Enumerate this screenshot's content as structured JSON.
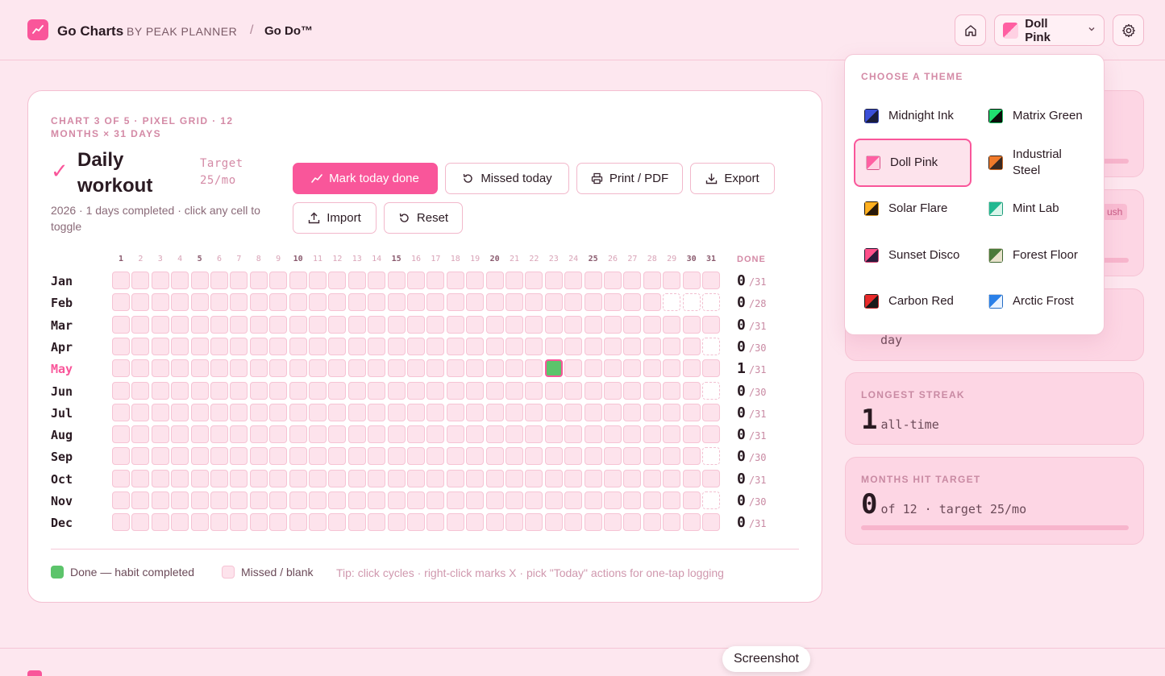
{
  "header": {
    "brand_title": "Go Charts",
    "brand_by": "BY PEAK PLANNER",
    "separator": "/",
    "crumb": "Go Do™",
    "theme_button_label": "Doll Pink"
  },
  "card": {
    "eyebrow": "CHART 3 OF 5 · PIXEL GRID · 12 MONTHS × 31 DAYS",
    "check": "✓",
    "title": "Daily workout",
    "target": "Target 25/mo",
    "subline": "2026 · 1 days completed · click any cell to toggle",
    "buttons": {
      "mark": "Mark today done",
      "missed": "Missed today",
      "print": "Print / PDF",
      "export": "Export",
      "import": "Import",
      "reset": "Reset"
    },
    "done_header": "DONE",
    "legend_done": "Done — habit completed",
    "legend_missed": "Missed / blank",
    "tip": "Tip: click cycles · right-click marks X · pick \"Today\" actions for one-tap logging"
  },
  "chart_data": {
    "type": "heatmap",
    "x": [
      1,
      2,
      3,
      4,
      5,
      6,
      7,
      8,
      9,
      10,
      11,
      12,
      13,
      14,
      15,
      16,
      17,
      18,
      19,
      20,
      21,
      22,
      23,
      24,
      25,
      26,
      27,
      28,
      29,
      30,
      31
    ],
    "bold_days": [
      1,
      5,
      10,
      15,
      20,
      25,
      30,
      31
    ],
    "months": [
      {
        "name": "Jan",
        "days": 31,
        "done": 0,
        "done_days": []
      },
      {
        "name": "Feb",
        "days": 28,
        "done": 0,
        "done_days": []
      },
      {
        "name": "Mar",
        "days": 31,
        "done": 0,
        "done_days": []
      },
      {
        "name": "Apr",
        "days": 30,
        "done": 0,
        "done_days": []
      },
      {
        "name": "May",
        "days": 31,
        "done": 1,
        "done_days": [
          23
        ],
        "current": true
      },
      {
        "name": "Jun",
        "days": 30,
        "done": 0,
        "done_days": []
      },
      {
        "name": "Jul",
        "days": 31,
        "done": 0,
        "done_days": []
      },
      {
        "name": "Aug",
        "days": 31,
        "done": 0,
        "done_days": []
      },
      {
        "name": "Sep",
        "days": 30,
        "done": 0,
        "done_days": []
      },
      {
        "name": "Oct",
        "days": 31,
        "done": 0,
        "done_days": []
      },
      {
        "name": "Nov",
        "days": 30,
        "done": 0,
        "done_days": []
      },
      {
        "name": "Dec",
        "days": 31,
        "done": 0,
        "done_days": []
      }
    ]
  },
  "stats": {
    "chip_text": "ush",
    "streak_unit": "day",
    "longest_label": "LONGEST STREAK",
    "longest_value": "1",
    "longest_unit": "all-time",
    "months_label": "MONTHS HIT TARGET",
    "months_value": "0",
    "months_unit": "of 12 · target 25/mo"
  },
  "theme_menu": {
    "label": "CHOOSE A THEME",
    "options": [
      {
        "name": "Midnight Ink",
        "c1": "#3b4fd8",
        "c2": "#1a1d3a"
      },
      {
        "name": "Matrix Green",
        "c1": "#20e070",
        "c2": "#0a0f0a"
      },
      {
        "name": "Doll Pink",
        "c1": "#ff5fa2",
        "c2": "#ffd1e3",
        "selected": true
      },
      {
        "name": "Industrial Steel",
        "c1": "#f07a2a",
        "c2": "#3a2a22"
      },
      {
        "name": "Solar Flare",
        "c1": "#ffb020",
        "c2": "#2a1a0a"
      },
      {
        "name": "Mint Lab",
        "c1": "#20b890",
        "c2": "#d8f5ea"
      },
      {
        "name": "Sunset Disco",
        "c1": "#ff4f8a",
        "c2": "#2a1a3a"
      },
      {
        "name": "Forest Floor",
        "c1": "#4a7a3a",
        "c2": "#e8e2cc"
      },
      {
        "name": "Carbon Red",
        "c1": "#e82a2a",
        "c2": "#1a1a1a"
      },
      {
        "name": "Arctic Frost",
        "c1": "#2a80e8",
        "c2": "#e8f2ff"
      }
    ]
  },
  "tooltip": "Screenshot",
  "colors": {
    "accent": "#f9569a",
    "done": "#5cc46b",
    "cell": "#fde3ec"
  }
}
